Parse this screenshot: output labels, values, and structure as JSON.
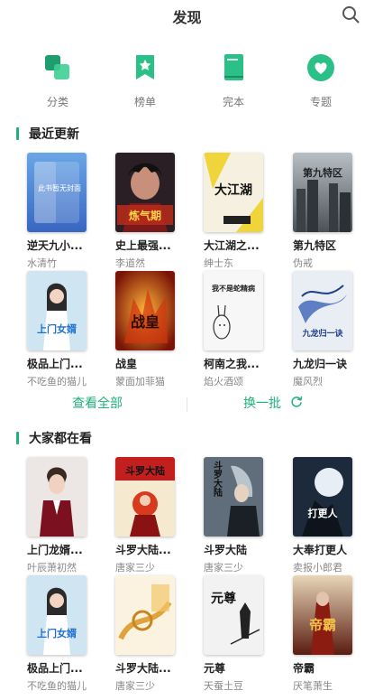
{
  "header": {
    "title": "发现"
  },
  "categories": [
    {
      "label": "分类",
      "icon": "category-icon"
    },
    {
      "label": "榜单",
      "icon": "ranking-icon"
    },
    {
      "label": "完本",
      "icon": "completed-book-icon"
    },
    {
      "label": "专题",
      "icon": "topic-heart-icon"
    }
  ],
  "section_recent": {
    "title": "最近更新",
    "books": [
      {
        "name": "逆天九小...",
        "author": "水清竹",
        "cover_text": "此书暂无封面"
      },
      {
        "name": "史上最强...",
        "author": "李道然",
        "cover_text": "炼气期"
      },
      {
        "name": "大江湖之...",
        "author": "绅士东",
        "cover_text": "大江湖"
      },
      {
        "name": "第九特区",
        "author": "伪戒",
        "cover_text": "第九特区"
      },
      {
        "name": "极品上门...",
        "author": "不吃鱼的猫儿",
        "cover_text": "上门女婿"
      },
      {
        "name": "战皇",
        "author": "蒙面加菲猫",
        "cover_text": "战皇"
      },
      {
        "name": "柯南之我...",
        "author": "焰火酒颂",
        "cover_text": "我不是蛇精病"
      },
      {
        "name": "九龙归一诀",
        "author": "魔风烈",
        "cover_text": "九龙归一诀"
      }
    ]
  },
  "actions": {
    "view_all": "查看全部",
    "refresh": "换一批"
  },
  "section_popular": {
    "title": "大家都在看",
    "books": [
      {
        "name": "上门龙婿...",
        "author": "叶辰萧初然",
        "cover_text": ""
      },
      {
        "name": "斗罗大陆...",
        "author": "唐家三少",
        "cover_text": "斗罗大陆"
      },
      {
        "name": "斗罗大陆",
        "author": "唐家三少",
        "cover_text": "斗罗大陆"
      },
      {
        "name": "大奉打更人",
        "author": "卖报小郎君",
        "cover_text": "打更人"
      },
      {
        "name": "极品上门...",
        "author": "不吃鱼的猫儿",
        "cover_text": "上门女婿"
      },
      {
        "name": "斗罗大陆...",
        "author": "唐家三少",
        "cover_text": ""
      },
      {
        "name": "元尊",
        "author": "天蚕土豆",
        "cover_text": "元尊"
      },
      {
        "name": "帝霸",
        "author": "厌笔萧生",
        "cover_text": "帝霸"
      }
    ]
  },
  "colors": {
    "accent": "#20b07a"
  }
}
